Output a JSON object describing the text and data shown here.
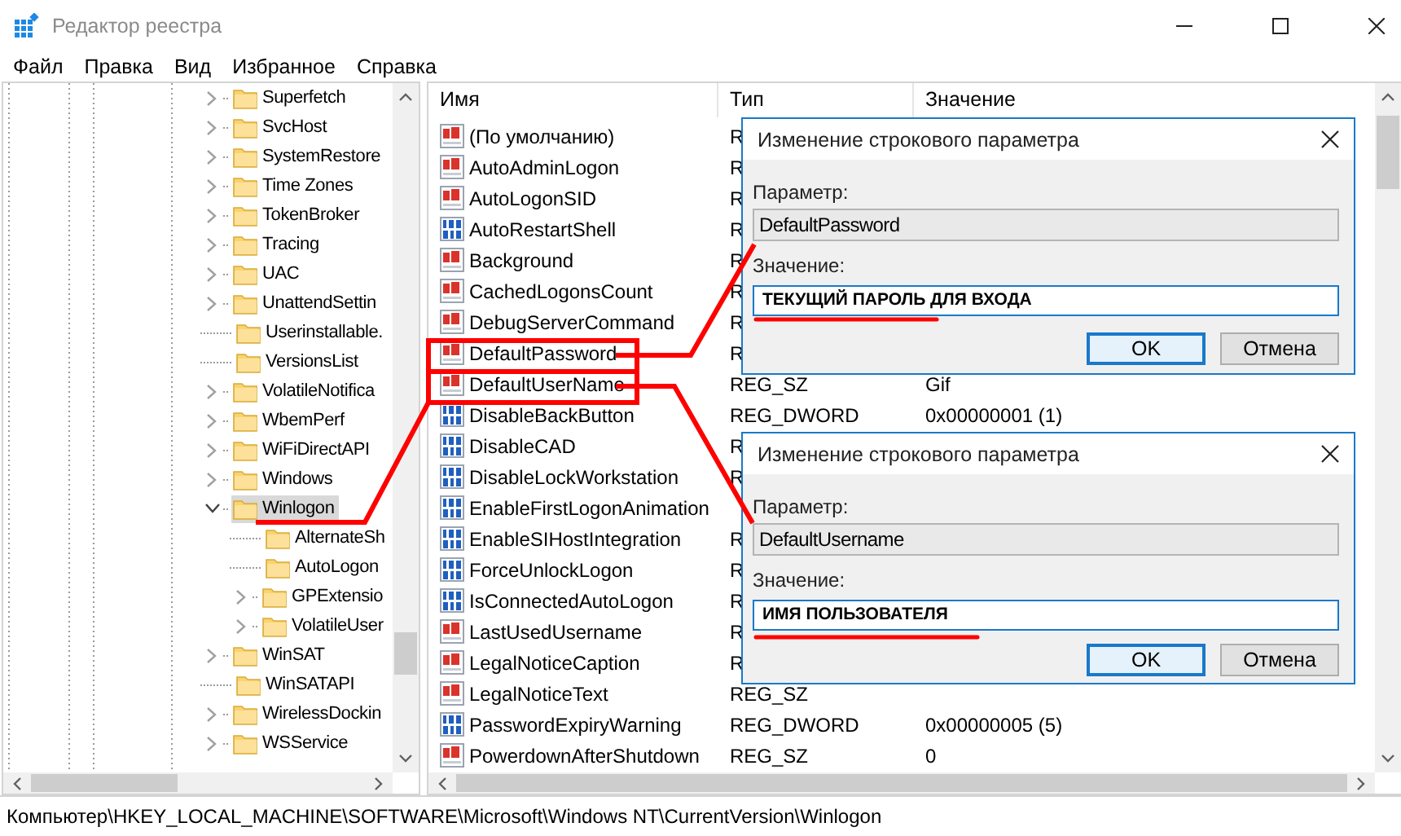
{
  "window": {
    "title": "Редактор реестра"
  },
  "menu": [
    "Файл",
    "Правка",
    "Вид",
    "Избранное",
    "Справка"
  ],
  "tree": {
    "items": [
      {
        "label": "Superfetch",
        "has_children": true,
        "expanded": false,
        "selected": false
      },
      {
        "label": "SvcHost",
        "has_children": true,
        "expanded": false,
        "selected": false
      },
      {
        "label": "SystemRestore",
        "has_children": true,
        "expanded": false,
        "selected": false
      },
      {
        "label": "Time Zones",
        "has_children": true,
        "expanded": false,
        "selected": false
      },
      {
        "label": "TokenBroker",
        "has_children": true,
        "expanded": false,
        "selected": false
      },
      {
        "label": "Tracing",
        "has_children": true,
        "expanded": false,
        "selected": false
      },
      {
        "label": "UAC",
        "has_children": true,
        "expanded": false,
        "selected": false
      },
      {
        "label": "UnattendSettin",
        "has_children": true,
        "expanded": false,
        "selected": false
      },
      {
        "label": "Userinstallable.",
        "has_children": false,
        "selected": false
      },
      {
        "label": "VersionsList",
        "has_children": false,
        "selected": false
      },
      {
        "label": "VolatileNotifica",
        "has_children": true,
        "expanded": false,
        "selected": false
      },
      {
        "label": "WbemPerf",
        "has_children": true,
        "expanded": false,
        "selected": false
      },
      {
        "label": "WiFiDirectAPI",
        "has_children": true,
        "expanded": false,
        "selected": false
      },
      {
        "label": "Windows",
        "has_children": true,
        "expanded": false,
        "selected": false
      },
      {
        "label": "Winlogon",
        "has_children": true,
        "expanded": true,
        "selected": true,
        "children": [
          {
            "label": "AlternateSh",
            "has_children": false,
            "selected": false
          },
          {
            "label": "AutoLogon",
            "has_children": false,
            "selected": false
          },
          {
            "label": "GPExtensio",
            "has_children": true,
            "expanded": false,
            "selected": false
          },
          {
            "label": "VolatileUser",
            "has_children": true,
            "expanded": false,
            "selected": false
          }
        ]
      },
      {
        "label": "WinSAT",
        "has_children": true,
        "expanded": false,
        "selected": false
      },
      {
        "label": "WinSATAPI",
        "has_children": false,
        "selected": false
      },
      {
        "label": "WirelessDockin",
        "has_children": true,
        "expanded": false,
        "selected": false
      },
      {
        "label": "WSService",
        "has_children": true,
        "expanded": false,
        "selected": false
      }
    ]
  },
  "values": {
    "columns": [
      "Имя",
      "Тип",
      "Значение"
    ],
    "rows": [
      {
        "kind": "string",
        "name": "(По умолчанию)",
        "type": "R"
      },
      {
        "kind": "string",
        "name": "AutoAdminLogon",
        "type": "R"
      },
      {
        "kind": "string",
        "name": "AutoLogonSID",
        "type": "R"
      },
      {
        "kind": "dword",
        "name": "AutoRestartShell",
        "type": "R"
      },
      {
        "kind": "string",
        "name": "Background",
        "type": "R"
      },
      {
        "kind": "string",
        "name": "CachedLogonsCount",
        "type": "R"
      },
      {
        "kind": "string",
        "name": "DebugServerCommand",
        "type": "R"
      },
      {
        "kind": "string",
        "name": "DefaultPassword",
        "type": "R"
      },
      {
        "kind": "string",
        "name": "DefaultUserName",
        "type": "REG_SZ",
        "value": "Gif"
      },
      {
        "kind": "dword",
        "name": "DisableBackButton",
        "type": "REG_DWORD",
        "value": "0x00000001 (1)"
      },
      {
        "kind": "dword",
        "name": "DisableCAD",
        "type": "R"
      },
      {
        "kind": "dword",
        "name": "DisableLockWorkstation",
        "type": "R"
      },
      {
        "kind": "dword",
        "name": "EnableFirstLogonAnimation"
      },
      {
        "kind": "dword",
        "name": "EnableSIHostIntegration",
        "type": "R"
      },
      {
        "kind": "dword",
        "name": "ForceUnlockLogon",
        "type": "R"
      },
      {
        "kind": "dword",
        "name": "IsConnectedAutoLogon",
        "type": "R"
      },
      {
        "kind": "string",
        "name": "LastUsedUsername",
        "type": "R"
      },
      {
        "kind": "string",
        "name": "LegalNoticeCaption",
        "type": "R"
      },
      {
        "kind": "string",
        "name": "LegalNoticeText",
        "type": "REG_SZ"
      },
      {
        "kind": "dword",
        "name": "PasswordExpiryWarning",
        "type": "REG_DWORD",
        "value": "0x00000005 (5)"
      },
      {
        "kind": "string",
        "name": "PowerdownAfterShutdown",
        "type": "REG_SZ",
        "value": "0"
      }
    ]
  },
  "dialogs": [
    {
      "title": "Изменение строкового параметра",
      "param_label": "Параметр:",
      "param_value": "DefaultPassword",
      "value_label": "Значение:",
      "value": "ТЕКУЩИЙ ПАРОЛЬ ДЛЯ ВХОДА",
      "buttons": [
        {
          "label": "OK",
          "default": true
        },
        {
          "label": "Отмена",
          "default": false
        }
      ]
    },
    {
      "title": "Изменение строкового параметра",
      "param_label": "Параметр:",
      "param_value": "DefaultUsername",
      "value_label": "Значение:",
      "value": "ИМЯ ПОЛЬЗОВАТЕЛЯ",
      "buttons": [
        {
          "label": "OK",
          "default": true
        },
        {
          "label": "Отмена",
          "default": false
        }
      ]
    }
  ],
  "status_bar": "Компьютер\\HKEY_LOCAL_MACHINE\\SOFTWARE\\Microsoft\\Windows NT\\CurrentVersion\\Winlogon"
}
